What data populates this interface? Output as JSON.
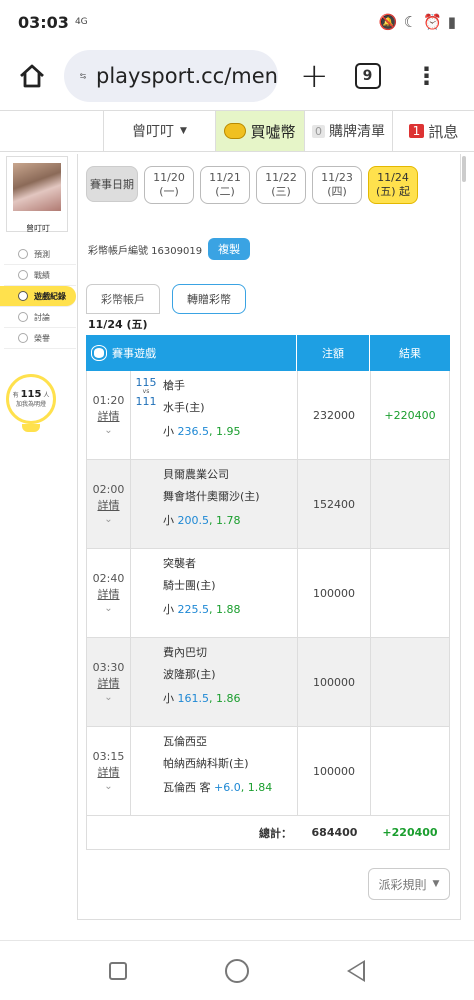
{
  "status": {
    "time": "03:03",
    "network": "4G",
    "icons": [
      "mute-icon",
      "moon-icon",
      "alarm-icon",
      "battery-icon"
    ]
  },
  "browser": {
    "url": "playsport.cc/men",
    "tab_count": "9"
  },
  "sitenav": {
    "user": "曾叮叮",
    "buy": "買噓幣",
    "cart_count": "0",
    "cart": "購牌清單",
    "msg_count": "1",
    "msg": "訊息"
  },
  "sidebar": {
    "name": "曾叮叮",
    "items": [
      {
        "label": "預測",
        "icon": "predict-icon"
      },
      {
        "label": "戰績",
        "icon": "record-icon"
      },
      {
        "label": "遊戲紀錄",
        "icon": "game-record-icon"
      },
      {
        "label": "討論",
        "icon": "discuss-icon"
      },
      {
        "label": "榮譽",
        "icon": "honor-icon"
      }
    ],
    "bulb_prefix": "有",
    "bulb_count": "115",
    "bulb_unit": "人",
    "bulb_text": "加我為明燈"
  },
  "main": {
    "date_label": "賽事日期",
    "dates": [
      {
        "date": "11/20",
        "day": "(一)"
      },
      {
        "date": "11/21",
        "day": "(二)"
      },
      {
        "date": "11/22",
        "day": "(三)"
      },
      {
        "date": "11/23",
        "day": "(四)"
      },
      {
        "date": "11/24",
        "day": "(五) 起"
      }
    ],
    "account_label": "彩幣帳戶編號 16309019",
    "copy_label": "複製",
    "tabs": [
      "彩幣帳戶",
      "轉贈彩幣"
    ],
    "day_label": "11/24 (五)",
    "table": {
      "headers": [
        "賽事遊戲",
        "注額",
        "結果"
      ],
      "rows": [
        {
          "time": "01:20",
          "detail": "詳情",
          "score_a": "115",
          "vs": "vs",
          "score_b": "111",
          "team_a": "槍手",
          "team_b": "水手(主)",
          "pick_prefix": "小 ",
          "pick_num": "236.5",
          "pick_odd": ", 1.95",
          "bet": "232000",
          "result": "+220400"
        },
        {
          "time": "02:00",
          "detail": "詳情",
          "score_a": "",
          "vs": "",
          "score_b": "",
          "team_a": "貝爾農業公司",
          "team_b": "舞會塔什奧爾沙(主)",
          "pick_prefix": "小 ",
          "pick_num": "200.5",
          "pick_odd": ", 1.78",
          "bet": "152400",
          "result": ""
        },
        {
          "time": "02:40",
          "detail": "詳情",
          "score_a": "",
          "vs": "",
          "score_b": "",
          "team_a": "突襲者",
          "team_b": "騎士團(主)",
          "pick_prefix": "小 ",
          "pick_num": "225.5",
          "pick_odd": ", 1.88",
          "bet": "100000",
          "result": ""
        },
        {
          "time": "03:30",
          "detail": "詳情",
          "score_a": "",
          "vs": "",
          "score_b": "",
          "team_a": "費內巴切",
          "team_b": "波隆那(主)",
          "pick_prefix": "小 ",
          "pick_num": "161.5",
          "pick_odd": ", 1.86",
          "bet": "100000",
          "result": ""
        },
        {
          "time": "03:15",
          "detail": "詳情",
          "score_a": "",
          "vs": "",
          "score_b": "",
          "team_a": "瓦倫西亞",
          "team_b": "帕納西納科斯(主)",
          "pick_prefix": "瓦倫西 客 ",
          "pick_num": "+6.0",
          "pick_odd": ", 1.84",
          "bet": "100000",
          "result": ""
        }
      ],
      "total_label": "總計：",
      "total_bet": "684400",
      "total_result": "+220400"
    },
    "rule_label": "派彩規則"
  }
}
